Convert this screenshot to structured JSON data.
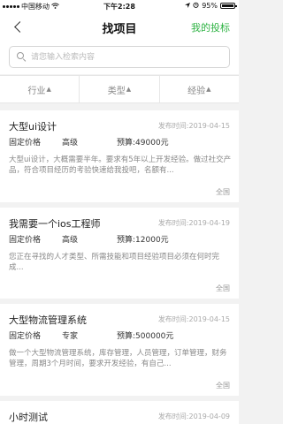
{
  "status_bar": {
    "carrier": "中国移动",
    "time": "下午2:28",
    "battery": "95%"
  },
  "nav": {
    "title": "找项目",
    "my_bids": "我的投标"
  },
  "search": {
    "placeholder": "请您输入检索内容",
    "value": ""
  },
  "filters": [
    {
      "label": "行业",
      "arrow": "▲"
    },
    {
      "label": "类型",
      "arrow": "▲"
    },
    {
      "label": "经验",
      "arrow": "▲"
    }
  ],
  "projects": [
    {
      "title": "大型ui设计",
      "date": "发布时间:2019-04-15",
      "pricing": "固定价格",
      "level": "高级",
      "budget_label": "预算:",
      "budget": "49000元",
      "description": "大型ui设计，大概需要半年。要求有5年以上开发经验。做过社交产品，符合项目经历的考验快速给我投吧，名额有...",
      "region": "全国"
    },
    {
      "title": "我需要一个ios工程师",
      "date": "发布时间:2019-04-19",
      "pricing": "固定价格",
      "level": "高级",
      "budget_label": "预算:",
      "budget": "12000元",
      "description": "您正在寻找的人才类型、所需技能和项目经验项目必须在何时完成...",
      "region": "全国"
    },
    {
      "title": "大型物流管理系统",
      "date": "发布时间:2019-04-15",
      "pricing": "固定价格",
      "level": "专家",
      "budget_label": "预算:",
      "budget": "500000元",
      "description": "做一个大型物流管理系统，库存管理，人员管理，订单管理，财务管理，周期3个月时间，要求开发经验，有自己...",
      "region": "全国"
    },
    {
      "title": "小时测试",
      "date": "发布时间:2019-04-09"
    }
  ]
}
